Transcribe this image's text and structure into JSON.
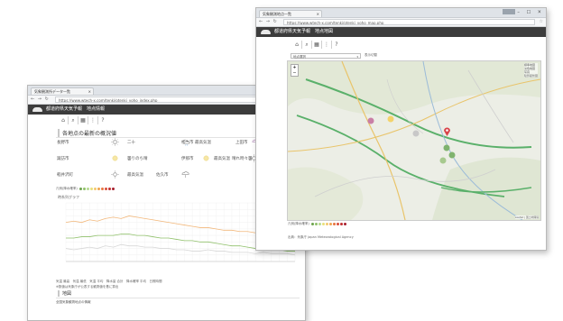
{
  "back_window": {
    "tab_title": "気象観測所データ一覧",
    "url": "https://www.wtech-x.com/tenki/otenki_yoho_index.php",
    "app_name": "都道府県天気予報　地点情報",
    "toolbar_icons": [
      "home-icon",
      "search-icon",
      "grid-icon",
      "help-icon"
    ],
    "forecast_title": "各地点の最新の概況値",
    "forecast": [
      {
        "place": "長野市",
        "weather": "sunny",
        "temp": "二十"
      },
      {
        "place": "松本市",
        "weather": "sun-cloud-rain",
        "temp": "最高気温"
      },
      {
        "place": "上田市",
        "weather": "rain"
      },
      {
        "place": "諏訪市",
        "weather": "sunny",
        "temp": "曇りのち晴"
      },
      {
        "place": "伊那市",
        "weather": "cloudy",
        "temp": "最高気温"
      },
      {
        "place": "飯田市",
        "weather": "sunny",
        "temp": "晴れ時々曇"
      },
      {
        "place": "軽井沢町",
        "weather": "sunny",
        "temp": "最高気温"
      },
      {
        "place": "佐久市",
        "weather": "rain"
      }
    ],
    "legend_label": "凡例(降水確率)",
    "legend_colors": [
      "#6da34d",
      "#8fc06a",
      "#b6d88f",
      "#e8e07a",
      "#f3c86b",
      "#f0a34f",
      "#e8753e",
      "#d94b3a",
      "#c22f2f",
      "#a51d2d"
    ],
    "chart_title": "時系列グラフ",
    "chart_legend": "気温 最高　気温 最低　気温 平均　降水量 合計　降水確率 平均　日照時間",
    "chart_note": "※数値は気象庁が公表する観測値を基に算出",
    "section_title": "地図",
    "section_sub": "全国気象観測地点の情報"
  },
  "front_window": {
    "tab_title": "気象観測地点一覧",
    "url": "https://www.wtech-x.com/tenki/otenki_yoho_map.php",
    "app_name": "都道府県天気予報　地点地図",
    "toolbar_icons": [
      "home-icon",
      "search-icon",
      "grid-icon",
      "help-icon"
    ],
    "select_value": "地点選択",
    "select_hint": "表示切替",
    "map_layers": [
      "標準地図",
      "淡色地図",
      "写真",
      "陰影起伏図"
    ],
    "map_attribution": "Leaflet | 国土地理院",
    "map_legend": "凡例(降水確率)",
    "legend_colors": [
      "#6da34d",
      "#8fc06a",
      "#b6d88f",
      "#e8e07a",
      "#f3c86b",
      "#f0a34f",
      "#e8753e",
      "#d94b3a",
      "#c22f2f",
      "#a51d2d"
    ],
    "map_note": "出典：気象庁 Japan Meteorological Agency"
  },
  "chart_data": {
    "type": "line",
    "x": [
      1,
      2,
      3,
      4,
      5,
      6,
      7,
      8,
      9,
      10,
      11,
      12,
      13,
      14,
      15,
      16,
      17,
      18,
      19,
      20,
      21,
      22,
      23,
      24,
      25,
      26,
      27,
      28,
      29,
      30
    ],
    "ylim": [
      0,
      45
    ],
    "series": [
      {
        "color": "#f2b77a",
        "values": [
          30,
          31,
          30,
          32,
          31,
          33,
          34,
          33,
          35,
          34,
          33,
          32,
          31,
          30,
          29,
          28,
          27,
          26,
          26,
          25,
          24,
          24,
          23,
          23,
          22,
          22,
          21,
          21,
          20,
          20
        ]
      },
      {
        "color": "#8fc06a",
        "values": [
          18,
          18,
          19,
          19,
          20,
          20,
          20,
          21,
          21,
          20,
          20,
          19,
          18,
          18,
          17,
          16,
          16,
          15,
          15,
          14,
          13,
          12,
          12,
          11,
          10,
          10,
          9,
          9,
          8,
          8
        ]
      },
      {
        "color": "#d7d7d7",
        "values": [
          10,
          9,
          10,
          11,
          10,
          12,
          11,
          13,
          12,
          12,
          11,
          11,
          10,
          10,
          9,
          9,
          8,
          8,
          9,
          8,
          8,
          7,
          7,
          7,
          6,
          7,
          6,
          6,
          6,
          5
        ]
      }
    ]
  }
}
